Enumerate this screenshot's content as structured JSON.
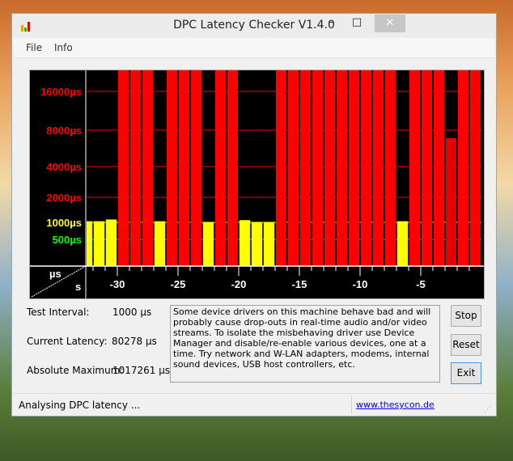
{
  "window": {
    "title": "DPC Latency Checker V1.4.0",
    "minimize": "–",
    "maximize": "□",
    "close": "✕"
  },
  "menu": [
    "File",
    "Info"
  ],
  "chart_data": {
    "type": "bar",
    "y_scale": "log",
    "y_tick_labels": [
      "16000µs",
      "8000µs",
      "4000µs",
      "2000µs",
      "1000µs",
      "500µs"
    ],
    "y_ticks": [
      16000,
      8000,
      4000,
      2000,
      1000,
      500
    ],
    "y_tick_colors": [
      "#ff0000",
      "#ff0000",
      "#ff0000",
      "#ff0000",
      "#ffff00",
      "#00ff00"
    ],
    "x_tick_labels": [
      "-30",
      "-25",
      "-20",
      "-15",
      "-10",
      "-5"
    ],
    "x_ticks": [
      -30,
      -25,
      -20,
      -15,
      -10,
      -5
    ],
    "corner_y_unit": "µs",
    "corner_x_unit": "s",
    "grid": true,
    "x_seconds_end": [
      -32,
      -31,
      -30,
      -29,
      -28,
      -27,
      -26,
      -25,
      -24,
      -23,
      -22,
      -21,
      -20,
      -19,
      -18,
      -17,
      -16,
      -15,
      -14,
      -13,
      -12,
      -11,
      -10,
      -9,
      -8,
      -7,
      -6,
      -5,
      -4,
      -3,
      -2,
      -1,
      0
    ],
    "values": [
      1030,
      1030,
      1080,
      25000,
      25000,
      25000,
      1030,
      25000,
      25000,
      25000,
      1010,
      25000,
      25000,
      1060,
      1010,
      1010,
      25000,
      25000,
      25000,
      25000,
      25000,
      25000,
      25000,
      25000,
      25000,
      25000,
      1030,
      25000,
      25000,
      25000,
      6900,
      25000,
      25000
    ],
    "colors": {
      "ok": "#ffff00",
      "bad": "#ff0000",
      "bad_partial": "#e80000"
    }
  },
  "stats": {
    "test_interval_label": "Test Interval:",
    "test_interval_value": "1000 µs",
    "current_latency_label": "Current Latency:",
    "current_latency_value": "80278 µs",
    "absolute_max_label": "Absolute Maximum:",
    "absolute_max_value": "1017261 µs"
  },
  "message": "Some device drivers on this machine behave bad and will probably cause drop-outs in real-time audio and/or video streams. To isolate the misbehaving driver use Device Manager and disable/re-enable various devices, one at a time. Try network and W-LAN adapters, modems, internal sound devices, USB host controllers, etc.",
  "buttons": {
    "stop": "Stop",
    "reset": "Reset",
    "exit": "Exit"
  },
  "status": {
    "text": "Analysing DPC latency ...",
    "link": "www.thesycon.de"
  }
}
